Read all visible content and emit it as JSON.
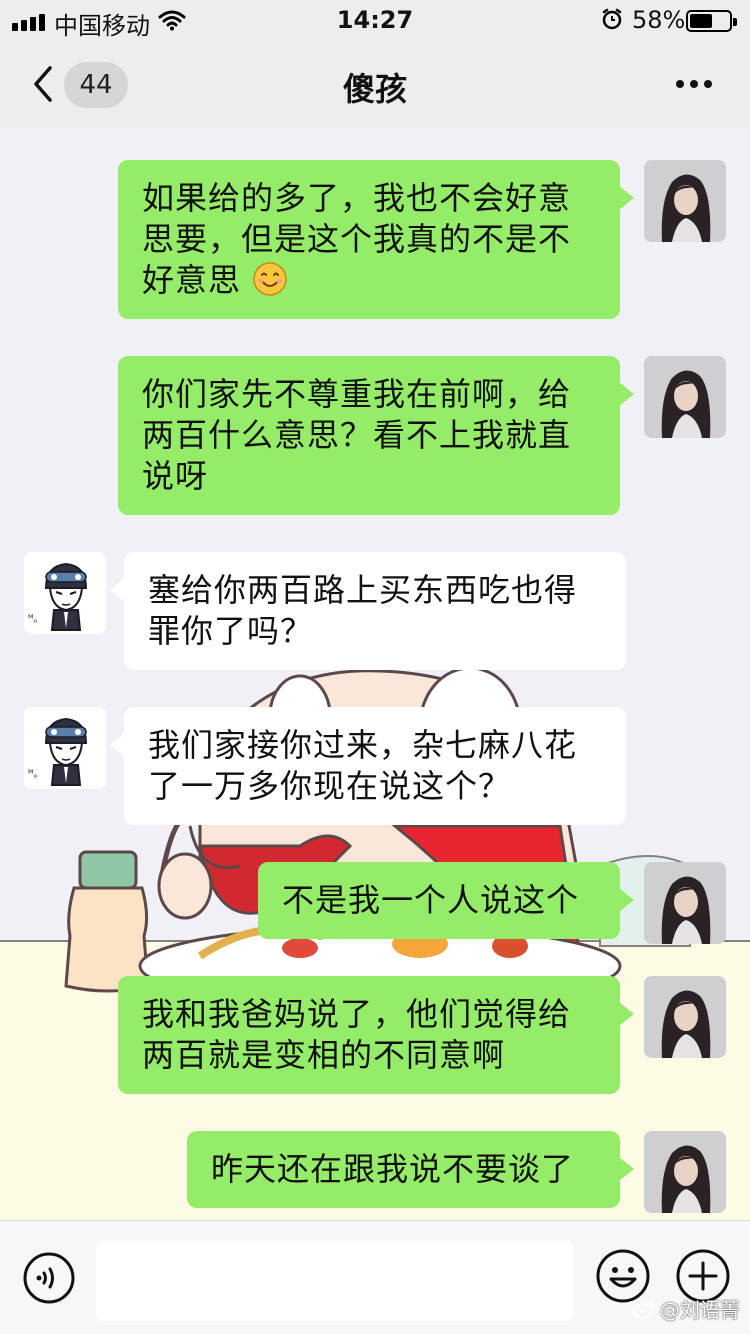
{
  "status_bar": {
    "carrier": "中国移动",
    "time": "14:27",
    "battery": "58%",
    "battery_level": 0.58
  },
  "nav": {
    "unread_count": "44",
    "title": "傻孩"
  },
  "messages": [
    {
      "sender": "me",
      "lines": [
        "如果给的多了，我也不会好意",
        "思要，但是这个我真的不是不",
        "好意思"
      ],
      "emoji": "smile-emoji"
    },
    {
      "sender": "me",
      "lines": [
        "你们家先不尊重我在前啊，给",
        "两百什么意思？看不上我就直",
        "说呀"
      ]
    },
    {
      "sender": "other",
      "lines": [
        "塞给你两百路上买东西吃也得",
        "罪你了吗？"
      ]
    },
    {
      "sender": "other",
      "lines": [
        "我们家接你过来，杂七麻八花",
        "了一万多你现在说这个？"
      ]
    },
    {
      "sender": "me",
      "lines": [
        "不是我一个人说这个"
      ]
    },
    {
      "sender": "me",
      "lines": [
        "我和我爸妈说了，他们觉得给",
        "两百就是变相的不同意啊"
      ]
    },
    {
      "sender": "me",
      "lines": [
        "昨天还在跟我说不要谈了"
      ]
    }
  ],
  "input": {
    "placeholder": "",
    "value": ""
  },
  "watermark": "@刘语菁",
  "icons": {
    "voice": "voice-icon",
    "emoji": "emoji-icon",
    "plus": "plus-icon",
    "back": "back-chevron-icon",
    "more": "more-dots-icon"
  },
  "colors": {
    "my_bubble": "#95ec69",
    "their_bubble": "#ffffff",
    "bar_bg": "#ededed"
  }
}
